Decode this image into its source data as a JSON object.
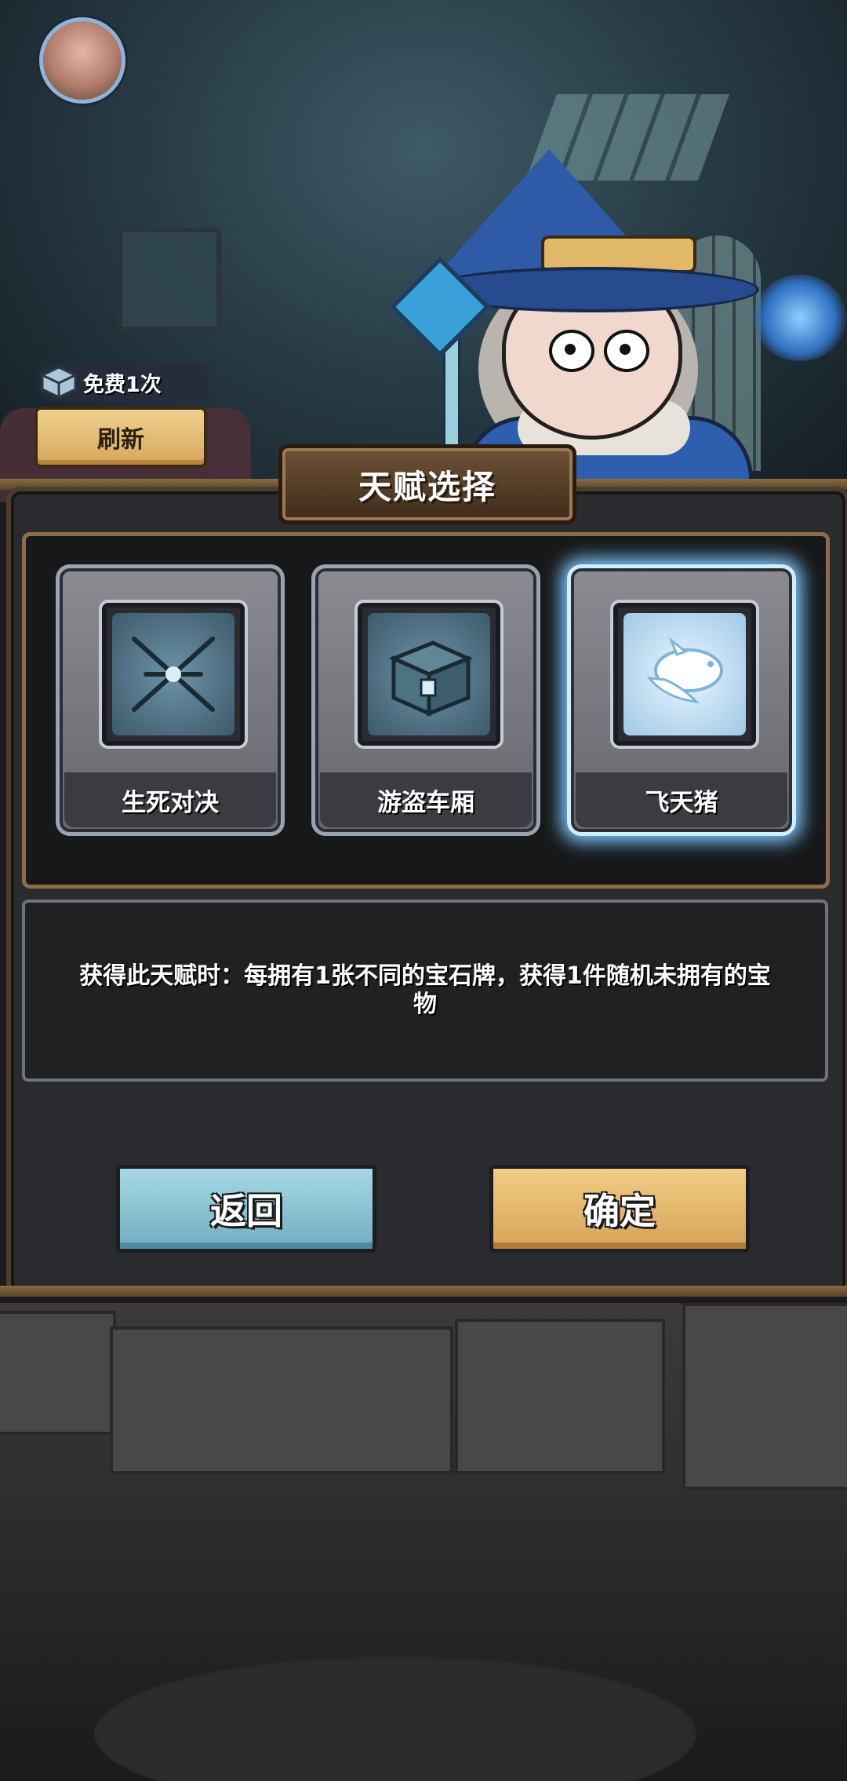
{
  "hud": {
    "avatar_icon": "pig-portrait-icon",
    "free_refresh_label": "免费1次",
    "refresh_button_label": "刷新"
  },
  "talent_panel": {
    "title": "天赋选择",
    "selected_index": 2,
    "options": [
      {
        "name": "生死对决",
        "icon": "crossed-swords-icon"
      },
      {
        "name": "游盗车厢",
        "icon": "treasure-chest-icon"
      },
      {
        "name": "飞天猪",
        "icon": "flying-pig-icon"
      }
    ],
    "description": "获得此天赋时：每拥有1张不同的宝石牌，获得1件随机未拥有的宝物"
  },
  "buttons": {
    "back_label": "返回",
    "confirm_label": "确定"
  },
  "colors": {
    "panel_bg": "#2a2b2e",
    "frame_gold": "#8b6e48",
    "back_button": "#8cc6d4",
    "confirm_button": "#e3b66c",
    "selected_glow": "#7bc6ff"
  }
}
